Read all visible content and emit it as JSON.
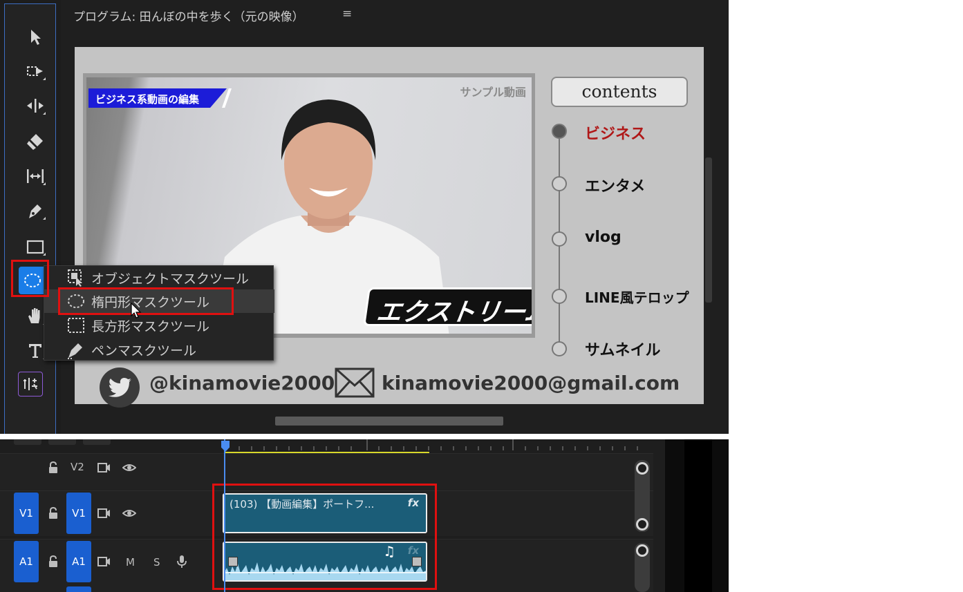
{
  "program_monitor": {
    "title": "プログラム: 田んぼの中を歩く（元の映像）",
    "menu_icon": "≡"
  },
  "toolbar": {
    "tools": [
      {
        "name": "selection-tool-icon"
      },
      {
        "name": "track-select-forward-tool-icon"
      },
      {
        "name": "ripple-edit-tool-icon"
      },
      {
        "name": "razor-tool-icon"
      },
      {
        "name": "slip-tool-icon"
      },
      {
        "name": "pen-tool-icon"
      },
      {
        "name": "rectangle-tool-icon"
      },
      {
        "name": "ellipse-mask-tool-icon",
        "active": true
      },
      {
        "name": "hand-tool-icon"
      },
      {
        "name": "type-tool-icon"
      },
      {
        "name": "remix-tool-icon"
      }
    ]
  },
  "mask_menu": {
    "items": [
      {
        "label": "オブジェクトマスクツール",
        "icon": "object-mask-icon"
      },
      {
        "label": "楕円形マスクツール",
        "icon": "ellipse-mask-icon"
      },
      {
        "label": "長方形マスクツール",
        "icon": "rectangle-mask-icon"
      },
      {
        "label": "ペンマスクツール",
        "icon": "pen-mask-icon"
      }
    ],
    "highlighted_index": 1
  },
  "video_frame": {
    "banner": "ビジネス系動画の編集",
    "sample_label": "サンプル動画",
    "caption": "エクストリーム",
    "contents_title": "contents",
    "contents_items": [
      {
        "label": "ビジネス",
        "active": true
      },
      {
        "label": "エンタメ",
        "active": false
      },
      {
        "label": "vlog",
        "active": false
      },
      {
        "label": "LINE風テロップ",
        "active": false
      },
      {
        "label": "サムネイル",
        "active": false
      }
    ],
    "twitter_handle": "@kinamovie2000",
    "email": "kinamovie2000@gmail.com"
  },
  "timeline": {
    "tracks": [
      {
        "source": "",
        "target": "V2",
        "type": "video"
      },
      {
        "source": "V1",
        "target": "V1",
        "type": "video"
      },
      {
        "source": "A1",
        "target": "A1",
        "type": "audio",
        "m": "M",
        "s": "S"
      }
    ],
    "clip_v1": {
      "name": "(103) 【動画編集】ポートフ...",
      "fx": "fx"
    },
    "clip_a1": {
      "fx": "fx",
      "note": "♫"
    }
  },
  "colors": {
    "highlight_red": "#e01010",
    "active_tool_blue": "#1a7de8",
    "track_blue": "#1a5fd0",
    "clip_teal": "#1b5d78",
    "active_item_red": "#b01818"
  }
}
